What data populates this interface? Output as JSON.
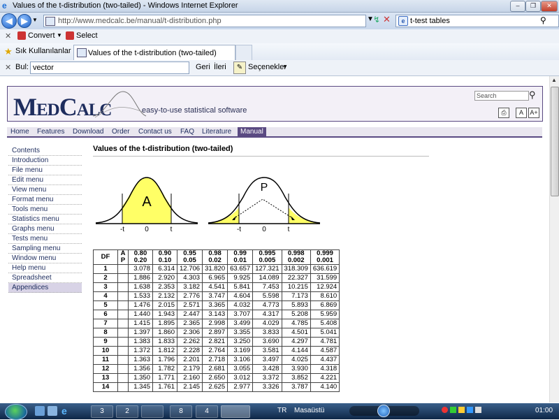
{
  "window": {
    "title": "Values of the t-distribution (two-tailed) - Windows Internet Explorer"
  },
  "browser": {
    "url": "http://www.medcalc.be/manual/t-distribution.php",
    "search_text": "t-test tables",
    "convert_label": "Convert",
    "select_label": "Select",
    "favorites_label": "Sık Kullanılanlar",
    "tab_label": "Values of the t-distribution (two-tailed)",
    "find_label": "Bul:",
    "find_value": "vector",
    "find_prev": "Geri",
    "find_next": "İleri",
    "options_label": "Seçenekler"
  },
  "site": {
    "logo": "MedCalc",
    "tagline": "easy-to-use statistical software",
    "search_placeholder": "Search",
    "nav": [
      "Home",
      "Features",
      "Download",
      "Order",
      "Contact us",
      "FAQ",
      "Literature",
      "Manual"
    ],
    "nav_active": "Manual",
    "sidebar": [
      "Contents",
      "Introduction",
      "File menu",
      "Edit menu",
      "View menu",
      "Format menu",
      "Tools menu",
      "Statistics menu",
      "Graphs menu",
      "Tests menu",
      "Sampling menu",
      "Window menu",
      "Help menu",
      "Spreadsheet",
      "Appendices"
    ],
    "sidebar_active": "Appendices"
  },
  "page": {
    "title": "Values of the t-distribution (two-tailed)",
    "figure1": {
      "area_label": "A",
      "ticks": [
        "-t",
        "0",
        "t"
      ]
    },
    "figure2": {
      "area_label": "P",
      "ticks": [
        "-t",
        "0",
        "t"
      ]
    }
  },
  "table": {
    "header": {
      "df": "DF",
      "ap": [
        "A",
        "P"
      ],
      "cols": [
        [
          "0.80",
          "0.20"
        ],
        [
          "0.90",
          "0.10"
        ],
        [
          "0.95",
          "0.05"
        ],
        [
          "0.98",
          "0.02"
        ],
        [
          "0.99",
          "0.01"
        ],
        [
          "0.995",
          "0.005"
        ],
        [
          "0.998",
          "0.002"
        ],
        [
          "0.999",
          "0.001"
        ]
      ]
    },
    "rows": [
      [
        "1",
        "3.078",
        "6.314",
        "12.706",
        "31.820",
        "63.657",
        "127.321",
        "318.309",
        "636.619"
      ],
      [
        "2",
        "1.886",
        "2.920",
        "4.303",
        "6.965",
        "9.925",
        "14.089",
        "22.327",
        "31.599"
      ],
      [
        "3",
        "1.638",
        "2.353",
        "3.182",
        "4.541",
        "5.841",
        "7.453",
        "10.215",
        "12.924"
      ],
      [
        "4",
        "1.533",
        "2.132",
        "2.776",
        "3.747",
        "4.604",
        "5.598",
        "7.173",
        "8.610"
      ],
      [
        "5",
        "1.476",
        "2.015",
        "2.571",
        "3.365",
        "4.032",
        "4.773",
        "5.893",
        "6.869"
      ],
      [
        "6",
        "1.440",
        "1.943",
        "2.447",
        "3.143",
        "3.707",
        "4.317",
        "5.208",
        "5.959"
      ],
      [
        "7",
        "1.415",
        "1.895",
        "2.365",
        "2.998",
        "3.499",
        "4.029",
        "4.785",
        "5.408"
      ],
      [
        "8",
        "1.397",
        "1.860",
        "2.306",
        "2.897",
        "3.355",
        "3.833",
        "4.501",
        "5.041"
      ],
      [
        "9",
        "1.383",
        "1.833",
        "2.262",
        "2.821",
        "3.250",
        "3.690",
        "4.297",
        "4.781"
      ],
      [
        "10",
        "1.372",
        "1.812",
        "2.228",
        "2.764",
        "3.169",
        "3.581",
        "4.144",
        "4.587"
      ],
      [
        "11",
        "1.363",
        "1.796",
        "2.201",
        "2.718",
        "3.106",
        "3.497",
        "4.025",
        "4.437"
      ],
      [
        "12",
        "1.356",
        "1.782",
        "2.179",
        "2.681",
        "3.055",
        "3.428",
        "3.930",
        "4.318"
      ],
      [
        "13",
        "1.350",
        "1.771",
        "2.160",
        "2.650",
        "3.012",
        "3.372",
        "3.852",
        "4.221"
      ],
      [
        "14",
        "1.345",
        "1.761",
        "2.145",
        "2.625",
        "2.977",
        "3.326",
        "3.787",
        "4.140"
      ]
    ]
  },
  "taskbar": {
    "buttons": [
      "3",
      "2",
      "",
      "8",
      "4"
    ],
    "lang": "TR",
    "desktop_label": "Masaüstü",
    "clock": "01:00"
  }
}
